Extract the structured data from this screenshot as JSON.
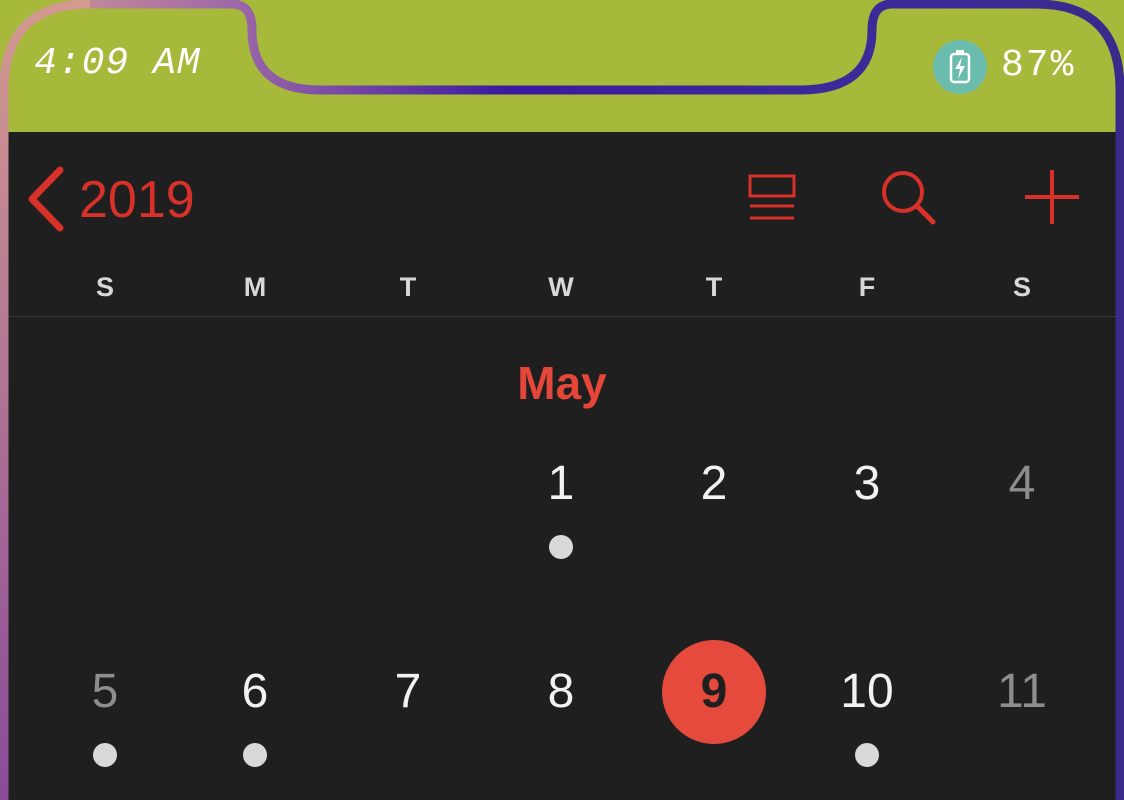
{
  "status_bar": {
    "time": "4:09 AM",
    "battery_percent": "87%",
    "battery_icon": "battery-charging-icon"
  },
  "nav": {
    "back_icon": "chevron-left-icon",
    "year": "2019",
    "list_icon": "list-view-icon",
    "search_icon": "search-icon",
    "add_icon": "plus-icon"
  },
  "weekdays": [
    "S",
    "M",
    "T",
    "W",
    "T",
    "F",
    "S"
  ],
  "month": "May",
  "week1": [
    {
      "day": "1",
      "has_event": true,
      "weekend": false,
      "today": false
    },
    {
      "day": "2",
      "has_event": false,
      "weekend": false,
      "today": false
    },
    {
      "day": "3",
      "has_event": false,
      "weekend": false,
      "today": false
    },
    {
      "day": "4",
      "has_event": false,
      "weekend": true,
      "today": false
    }
  ],
  "week2": [
    {
      "day": "5",
      "has_event": true,
      "weekend": true,
      "today": false
    },
    {
      "day": "6",
      "has_event": true,
      "weekend": false,
      "today": false
    },
    {
      "day": "7",
      "has_event": false,
      "weekend": false,
      "today": false
    },
    {
      "day": "8",
      "has_event": false,
      "weekend": false,
      "today": false
    },
    {
      "day": "9",
      "has_event": false,
      "weekend": false,
      "today": true
    },
    {
      "day": "10",
      "has_event": true,
      "weekend": false,
      "today": false
    },
    {
      "day": "11",
      "has_event": false,
      "weekend": true,
      "today": false
    }
  ],
  "colors": {
    "accent": "#e64a3d",
    "status_bar_bg": "#a6b93a",
    "app_bg": "#1f1f1f",
    "battery_badge": "#6abcad"
  }
}
